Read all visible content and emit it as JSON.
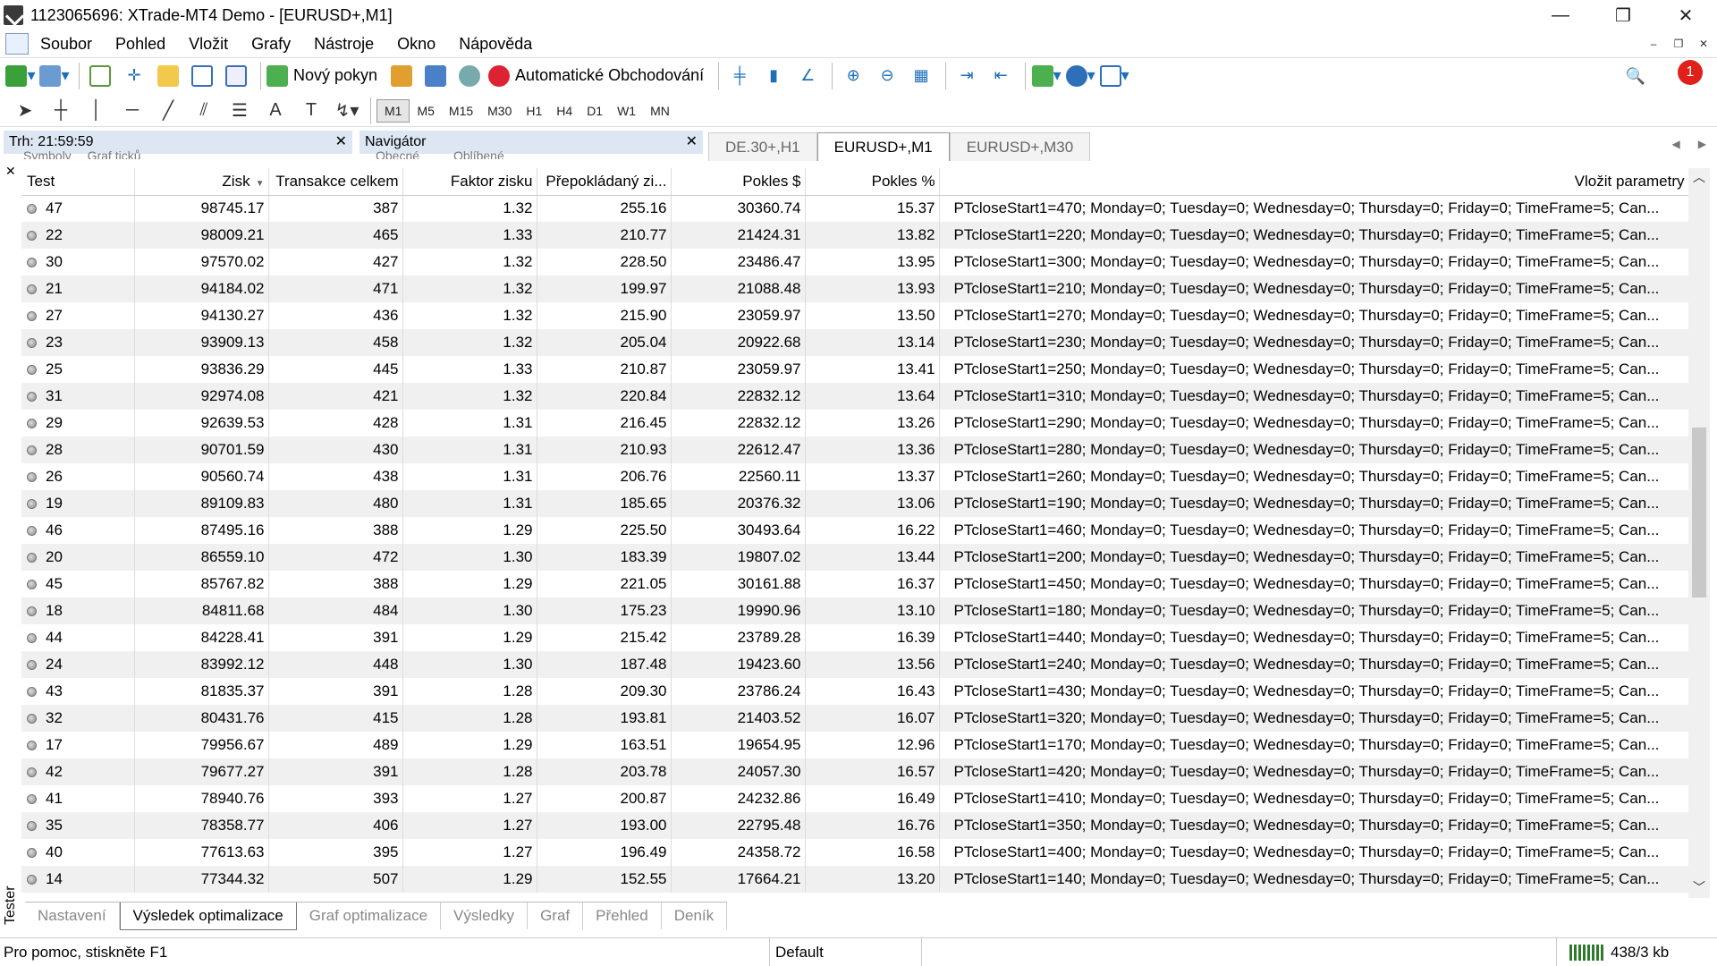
{
  "window": {
    "title": "1123065696: XTrade-MT4 Demo - [EURUSD+,M1]"
  },
  "menu": [
    "Soubor",
    "Pohled",
    "Vložit",
    "Grafy",
    "Nástroje",
    "Okno",
    "Nápověda"
  ],
  "toolbar": {
    "new_order": "Nový pokyn",
    "auto_trading": "Automatické Obchodování",
    "notification_count": "1"
  },
  "timeframes": [
    "M1",
    "M5",
    "M15",
    "M30",
    "H1",
    "H4",
    "D1",
    "W1",
    "MN"
  ],
  "market_watch": {
    "title": "Trh: 21:59:59",
    "tabs": [
      "Symboly",
      "Graf ticků"
    ]
  },
  "navigator": {
    "title": "Navigátor",
    "tabs": [
      "Obecné",
      "Oblíbené"
    ]
  },
  "chart_tabs": [
    "DE.30+,H1",
    "EURUSD+,M1",
    "EURUSD+,M30"
  ],
  "tester": {
    "label": "Tester",
    "columns": [
      "Test",
      "Zisk",
      "Transakce celkem",
      "Faktor zisku",
      "Přepokládaný zi...",
      "Pokles $",
      "Pokles %",
      "Vložit parametry"
    ],
    "rows": [
      [
        "47",
        "98745.17",
        "387",
        "1.32",
        "255.16",
        "30360.74",
        "15.37",
        "PTcloseStart1=470; Monday=0; Tuesday=0; Wednesday=0; Thursday=0; Friday=0; TimeFrame=5; Can..."
      ],
      [
        "22",
        "98009.21",
        "465",
        "1.33",
        "210.77",
        "21424.31",
        "13.82",
        "PTcloseStart1=220; Monday=0; Tuesday=0; Wednesday=0; Thursday=0; Friday=0; TimeFrame=5; Can..."
      ],
      [
        "30",
        "97570.02",
        "427",
        "1.32",
        "228.50",
        "23486.47",
        "13.95",
        "PTcloseStart1=300; Monday=0; Tuesday=0; Wednesday=0; Thursday=0; Friday=0; TimeFrame=5; Can..."
      ],
      [
        "21",
        "94184.02",
        "471",
        "1.32",
        "199.97",
        "21088.48",
        "13.93",
        "PTcloseStart1=210; Monday=0; Tuesday=0; Wednesday=0; Thursday=0; Friday=0; TimeFrame=5; Can..."
      ],
      [
        "27",
        "94130.27",
        "436",
        "1.32",
        "215.90",
        "23059.97",
        "13.50",
        "PTcloseStart1=270; Monday=0; Tuesday=0; Wednesday=0; Thursday=0; Friday=0; TimeFrame=5; Can..."
      ],
      [
        "23",
        "93909.13",
        "458",
        "1.32",
        "205.04",
        "20922.68",
        "13.14",
        "PTcloseStart1=230; Monday=0; Tuesday=0; Wednesday=0; Thursday=0; Friday=0; TimeFrame=5; Can..."
      ],
      [
        "25",
        "93836.29",
        "445",
        "1.33",
        "210.87",
        "23059.97",
        "13.41",
        "PTcloseStart1=250; Monday=0; Tuesday=0; Wednesday=0; Thursday=0; Friday=0; TimeFrame=5; Can..."
      ],
      [
        "31",
        "92974.08",
        "421",
        "1.32",
        "220.84",
        "22832.12",
        "13.64",
        "PTcloseStart1=310; Monday=0; Tuesday=0; Wednesday=0; Thursday=0; Friday=0; TimeFrame=5; Can..."
      ],
      [
        "29",
        "92639.53",
        "428",
        "1.31",
        "216.45",
        "22832.12",
        "13.26",
        "PTcloseStart1=290; Monday=0; Tuesday=0; Wednesday=0; Thursday=0; Friday=0; TimeFrame=5; Can..."
      ],
      [
        "28",
        "90701.59",
        "430",
        "1.31",
        "210.93",
        "22612.47",
        "13.36",
        "PTcloseStart1=280; Monday=0; Tuesday=0; Wednesday=0; Thursday=0; Friday=0; TimeFrame=5; Can..."
      ],
      [
        "26",
        "90560.74",
        "438",
        "1.31",
        "206.76",
        "22560.11",
        "13.37",
        "PTcloseStart1=260; Monday=0; Tuesday=0; Wednesday=0; Thursday=0; Friday=0; TimeFrame=5; Can..."
      ],
      [
        "19",
        "89109.83",
        "480",
        "1.31",
        "185.65",
        "20376.32",
        "13.06",
        "PTcloseStart1=190; Monday=0; Tuesday=0; Wednesday=0; Thursday=0; Friday=0; TimeFrame=5; Can..."
      ],
      [
        "46",
        "87495.16",
        "388",
        "1.29",
        "225.50",
        "30493.64",
        "16.22",
        "PTcloseStart1=460; Monday=0; Tuesday=0; Wednesday=0; Thursday=0; Friday=0; TimeFrame=5; Can..."
      ],
      [
        "20",
        "86559.10",
        "472",
        "1.30",
        "183.39",
        "19807.02",
        "13.44",
        "PTcloseStart1=200; Monday=0; Tuesday=0; Wednesday=0; Thursday=0; Friday=0; TimeFrame=5; Can..."
      ],
      [
        "45",
        "85767.82",
        "388",
        "1.29",
        "221.05",
        "30161.88",
        "16.37",
        "PTcloseStart1=450; Monday=0; Tuesday=0; Wednesday=0; Thursday=0; Friday=0; TimeFrame=5; Can..."
      ],
      [
        "18",
        "84811.68",
        "484",
        "1.30",
        "175.23",
        "19990.96",
        "13.10",
        "PTcloseStart1=180; Monday=0; Tuesday=0; Wednesday=0; Thursday=0; Friday=0; TimeFrame=5; Can..."
      ],
      [
        "44",
        "84228.41",
        "391",
        "1.29",
        "215.42",
        "23789.28",
        "16.39",
        "PTcloseStart1=440; Monday=0; Tuesday=0; Wednesday=0; Thursday=0; Friday=0; TimeFrame=5; Can..."
      ],
      [
        "24",
        "83992.12",
        "448",
        "1.30",
        "187.48",
        "19423.60",
        "13.56",
        "PTcloseStart1=240; Monday=0; Tuesday=0; Wednesday=0; Thursday=0; Friday=0; TimeFrame=5; Can..."
      ],
      [
        "43",
        "81835.37",
        "391",
        "1.28",
        "209.30",
        "23786.24",
        "16.43",
        "PTcloseStart1=430; Monday=0; Tuesday=0; Wednesday=0; Thursday=0; Friday=0; TimeFrame=5; Can..."
      ],
      [
        "32",
        "80431.76",
        "415",
        "1.28",
        "193.81",
        "21403.52",
        "16.07",
        "PTcloseStart1=320; Monday=0; Tuesday=0; Wednesday=0; Thursday=0; Friday=0; TimeFrame=5; Can..."
      ],
      [
        "17",
        "79956.67",
        "489",
        "1.29",
        "163.51",
        "19654.95",
        "12.96",
        "PTcloseStart1=170; Monday=0; Tuesday=0; Wednesday=0; Thursday=0; Friday=0; TimeFrame=5; Can..."
      ],
      [
        "42",
        "79677.27",
        "391",
        "1.28",
        "203.78",
        "24057.30",
        "16.57",
        "PTcloseStart1=420; Monday=0; Tuesday=0; Wednesday=0; Thursday=0; Friday=0; TimeFrame=5; Can..."
      ],
      [
        "41",
        "78940.76",
        "393",
        "1.27",
        "200.87",
        "24232.86",
        "16.49",
        "PTcloseStart1=410; Monday=0; Tuesday=0; Wednesday=0; Thursday=0; Friday=0; TimeFrame=5; Can..."
      ],
      [
        "35",
        "78358.77",
        "406",
        "1.27",
        "193.00",
        "22795.48",
        "16.76",
        "PTcloseStart1=350; Monday=0; Tuesday=0; Wednesday=0; Thursday=0; Friday=0; TimeFrame=5; Can..."
      ],
      [
        "40",
        "77613.63",
        "395",
        "1.27",
        "196.49",
        "24358.72",
        "16.58",
        "PTcloseStart1=400; Monday=0; Tuesday=0; Wednesday=0; Thursday=0; Friday=0; TimeFrame=5; Can..."
      ],
      [
        "14",
        "77344.32",
        "507",
        "1.29",
        "152.55",
        "17664.21",
        "13.20",
        "PTcloseStart1=140; Monday=0; Tuesday=0; Wednesday=0; Thursday=0; Friday=0; TimeFrame=5; Can..."
      ]
    ],
    "tabs": [
      "Nastavení",
      "Výsledek optimalizace",
      "Graf optimalizace",
      "Výsledky",
      "Graf",
      "Přehled",
      "Deník"
    ],
    "active_tab": "Výsledek optimalizace"
  },
  "status": {
    "help": "Pro pomoc, stiskněte F1",
    "profile": "Default",
    "traffic": "438/3 kb"
  }
}
